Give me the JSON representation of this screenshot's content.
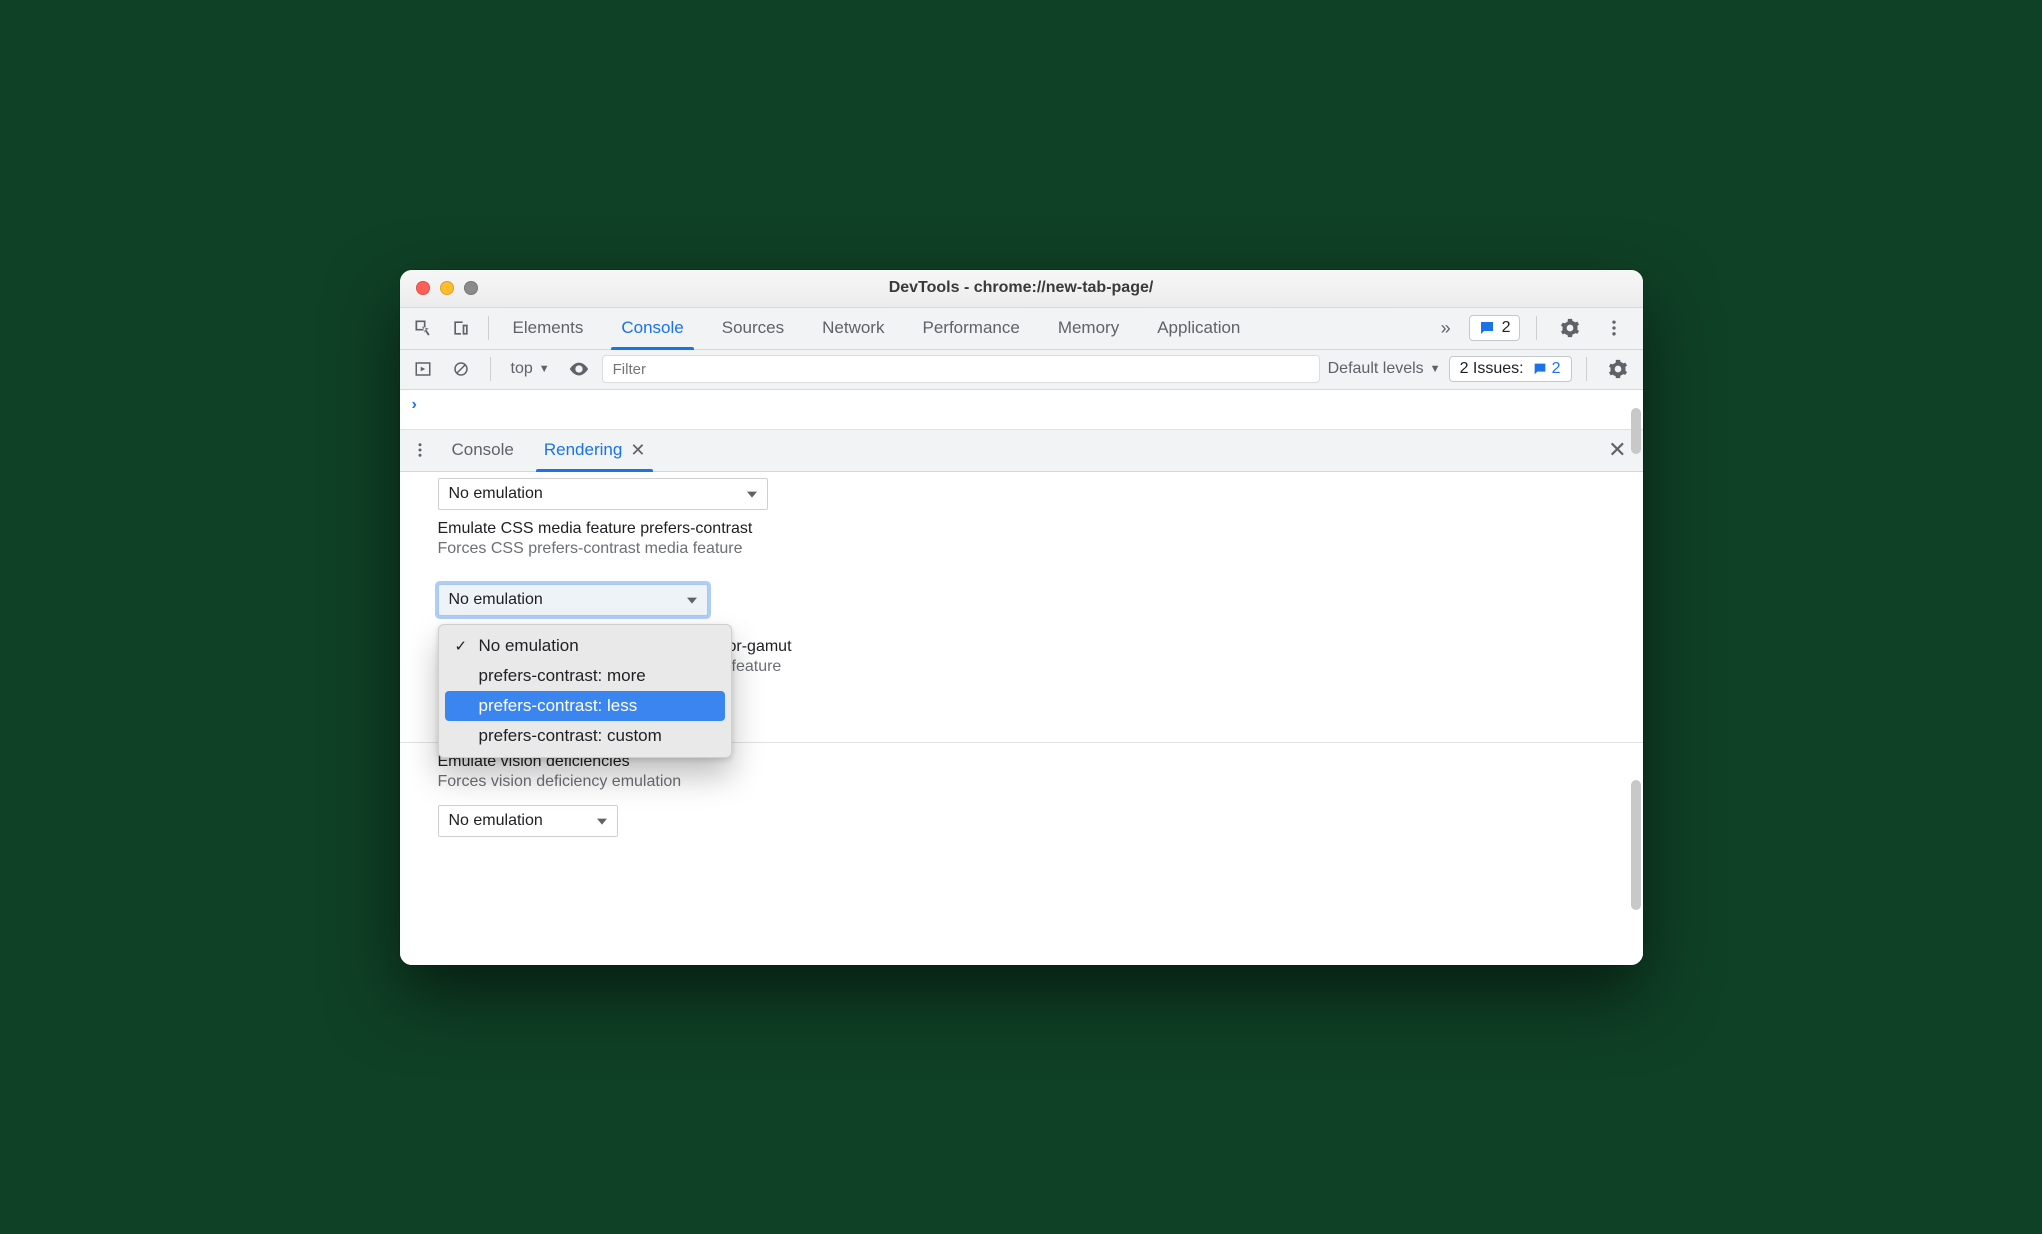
{
  "window_title": "DevTools - chrome://new-tab-page/",
  "main_tabs": {
    "elements": "Elements",
    "console": "Console",
    "sources": "Sources",
    "network": "Network",
    "performance": "Performance",
    "memory": "Memory",
    "application": "Application"
  },
  "toolbar_badge_count": "2",
  "filterbar": {
    "context": "top",
    "filter_placeholder": "Filter",
    "levels_label": "Default levels",
    "issues_text": "2 Issues:",
    "issues_count": "2"
  },
  "drawer": {
    "tab_console": "Console",
    "tab_rendering": "Rendering"
  },
  "rendering": {
    "select_top_value": "No emulation",
    "contrast_title": "Emulate CSS media feature prefers-contrast",
    "contrast_sub": "Forces CSS prefers-contrast media feature",
    "contrast_selected": "No emulation",
    "contrast_options": {
      "o0": "No emulation",
      "o1": "prefers-contrast: more",
      "o2": "prefers-contrast: less",
      "o3": "prefers-contrast: custom"
    },
    "gamut_title_part": "or-gamut",
    "gamut_sub_part": "feature",
    "vision_title": "Emulate vision deficiencies",
    "vision_sub": "Forces vision deficiency emulation",
    "vision_selected": "No emulation"
  }
}
